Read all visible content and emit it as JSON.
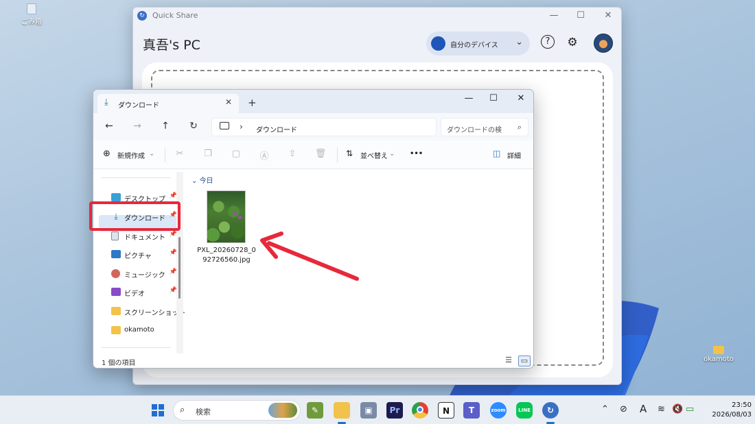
{
  "desktop": {
    "icons": [
      {
        "label": "ごみ箱",
        "icon": "recycle-bin-icon"
      },
      {
        "label": "okamoto",
        "icon": "folder-icon"
      }
    ]
  },
  "quickshare": {
    "title": "Quick Share",
    "pc_name": "真吾's PC",
    "device_select": "自分のデバイス",
    "controls": {
      "minimize": "—",
      "maximize": "☐",
      "close": "✕"
    },
    "help_icon": "?",
    "settings_icon": "⚙"
  },
  "explorer": {
    "tab_title": "ダウンロード",
    "new_tab": "+",
    "controls": {
      "minimize": "—",
      "maximize": "☐",
      "close": "✕"
    },
    "address": "ダウンロード",
    "search_placeholder": "ダウンロードの検",
    "toolbar": {
      "new_label": "新規作成",
      "sort_label": "並べ替え",
      "more_label": "•••",
      "details_label": "詳細"
    },
    "sidebar": [
      {
        "label": "デスクトップ",
        "icon": "desktop-icon",
        "color": "#3aa0d8",
        "pinned": true
      },
      {
        "label": "ダウンロード",
        "icon": "download-icon",
        "color": "#1a7b8c",
        "pinned": true
      },
      {
        "label": "ドキュメント",
        "icon": "document-icon",
        "color": "#7a8aa0",
        "pinned": true
      },
      {
        "label": "ピクチャ",
        "icon": "pictures-icon",
        "color": "#2b78c9",
        "pinned": true
      },
      {
        "label": "ミュージック",
        "icon": "music-icon",
        "color": "#d2665a",
        "pinned": true
      },
      {
        "label": "ビデオ",
        "icon": "video-icon",
        "color": "#8a4bc7",
        "pinned": true
      },
      {
        "label": "スクリーンショット",
        "icon": "folder-icon",
        "color": "#f2c24a",
        "pinned": false
      },
      {
        "label": "okamoto",
        "icon": "folder-icon",
        "color": "#f2c24a",
        "pinned": false
      }
    ],
    "group_header": "今日",
    "files": [
      {
        "name_line1": "PXL_20260728_0",
        "name_line2": "92726560.jpg"
      }
    ],
    "status": "1 個の項目"
  },
  "taskbar": {
    "search_placeholder": "検索",
    "time": "23:50",
    "date": "2026/08/03",
    "ime": "A"
  },
  "annotation": {
    "highlight_color": "#e8283b"
  }
}
